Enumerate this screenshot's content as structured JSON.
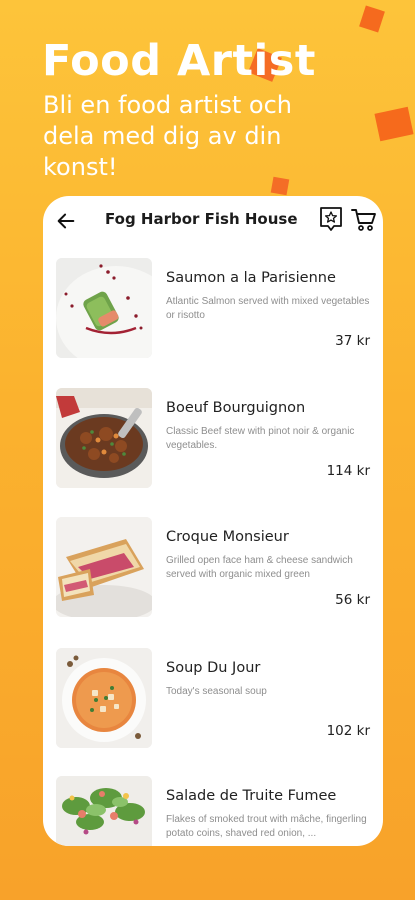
{
  "hero": {
    "title": "Food Artist",
    "subtitle": "Bli en food artist och dela med dig av din konst!"
  },
  "topbar": {
    "restaurant_name": "Fog Harbor Fish House",
    "icons": [
      "arrow-left-icon",
      "star-badge-icon",
      "cart-icon"
    ]
  },
  "menu": [
    {
      "name": "Saumon a la Parisienne",
      "description": "Atlantic Salmon served with mixed vegetables or risotto",
      "price": "37 kr"
    },
    {
      "name": "Boeuf Bourguignon",
      "description": "Classic Beef stew with pinot noir & organic vegetables.",
      "price": "114 kr"
    },
    {
      "name": "Croque Monsieur",
      "description": "Grilled open face ham & cheese sandwich served with organic mixed green",
      "price": "56 kr"
    },
    {
      "name": "Soup Du Jour",
      "description": "Today's seasonal soup",
      "price": "102 kr"
    },
    {
      "name": "Salade de Truite Fumee",
      "description": "Flakes of smoked trout with mâche, fingerling potato coins, shaved red onion, ...",
      "price": ""
    }
  ],
  "colors": {
    "background": "#FBB22E",
    "accent": "#F56A1E",
    "card": "#FFFFFF"
  }
}
